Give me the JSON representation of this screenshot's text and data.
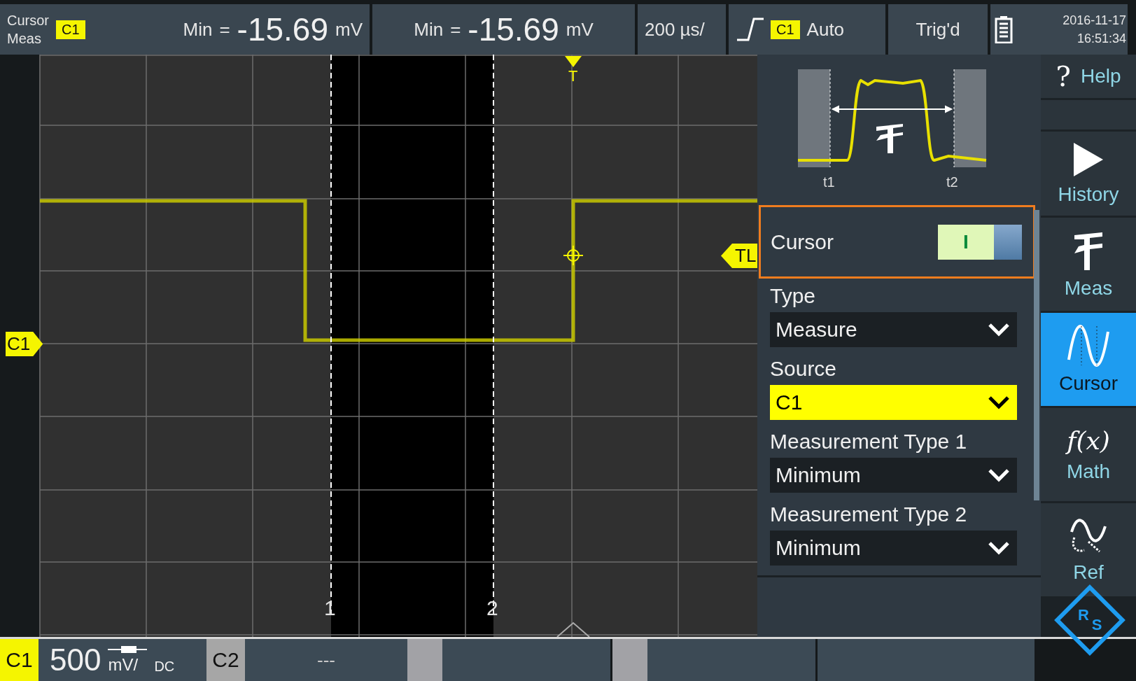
{
  "top_bar": {
    "mode_lines": [
      "Cursor",
      "Meas"
    ],
    "source_badge": "C1",
    "readouts": [
      {
        "label": "Min",
        "equals": "=",
        "value": "-15.69",
        "unit": "mV"
      },
      {
        "label": "Min",
        "equals": "=",
        "value": "-15.69",
        "unit": "mV"
      }
    ],
    "timebase": "200 µs/",
    "trigger": {
      "source": "C1",
      "mode": "Auto"
    },
    "status": "Trig'd",
    "date": "2016-11-17",
    "time": "16:51:34"
  },
  "plot": {
    "channel_marker": "C1",
    "trigger_marker": "T",
    "trigger_level_marker": "TL",
    "cursors": [
      {
        "label": "1"
      },
      {
        "label": "2"
      }
    ]
  },
  "panel": {
    "diagram_labels": [
      "t1",
      "t2"
    ],
    "cursor_toggle": {
      "label": "Cursor",
      "on": true,
      "switch_mark": "I"
    },
    "fields": [
      {
        "label": "Type",
        "value": "Measure",
        "highlighted": false
      },
      {
        "label": "Source",
        "value": "C1",
        "highlighted": true
      },
      {
        "label": "Measurement Type 1",
        "value": "Minimum",
        "highlighted": false
      },
      {
        "label": "Measurement Type 2",
        "value": "Minimum",
        "highlighted": false
      }
    ]
  },
  "sidebar": [
    {
      "kind": "help",
      "glyph": "?",
      "label": "Help",
      "selected": false
    },
    {
      "kind": "partial",
      "selected": false
    },
    {
      "kind": "play",
      "label": "History",
      "selected": false
    },
    {
      "kind": "caliper",
      "label": "Meas",
      "selected": false
    },
    {
      "kind": "cursor",
      "label": "Cursor",
      "selected": true
    },
    {
      "kind": "fx",
      "glyph": "f(x)",
      "label": "Math",
      "selected": false
    },
    {
      "kind": "ref",
      "label": "Ref",
      "selected": false
    }
  ],
  "logo_letters": [
    "R",
    "S"
  ],
  "bottom_bar": {
    "channels": [
      {
        "name": "C1",
        "color": "#f5f500",
        "scale": "500",
        "unit": "mV/",
        "coupling": "DC"
      },
      {
        "name": "C2",
        "color": "#a6a6a6",
        "scale": "---"
      }
    ]
  }
}
